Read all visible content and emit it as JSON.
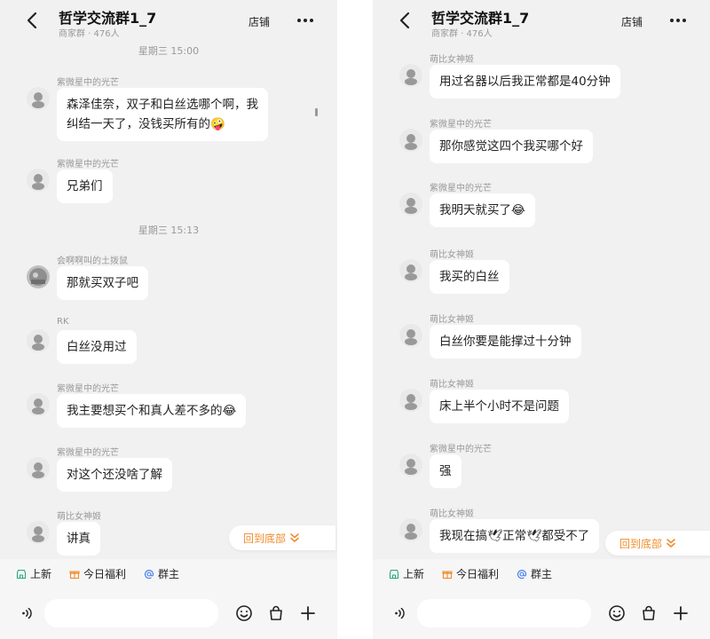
{
  "left": {
    "header": {
      "title": "哲学交流群1_7",
      "subtitle": "商家群 · 476人",
      "store_label": "店铺"
    },
    "timestamps": [
      "星期三 15:00",
      "星期三 15:13"
    ],
    "messages": [
      {
        "sender": "紫微星中的光芒",
        "lines": [
          "森泽佳奈，双子和白丝选哪个啊，我",
          "纠结一天了，没钱买所有的🤪"
        ]
      },
      {
        "sender": "紫微星中的光芒",
        "lines": [
          "兄弟们"
        ]
      },
      {
        "sender": "会啊啊叫的土拨鼠",
        "lines": [
          "那就买双子吧"
        ]
      },
      {
        "sender": "RK",
        "lines": [
          "白丝没用过"
        ]
      },
      {
        "sender": "紫微星中的光芒",
        "lines": [
          "我主要想买个和真人差不多的😂"
        ]
      },
      {
        "sender": "紫微星中的光芒",
        "lines": [
          "对这个还没啥了解"
        ]
      },
      {
        "sender": "萌比女神姬",
        "lines": [
          "讲真"
        ]
      }
    ],
    "jump_label": "回到底部",
    "shortcuts": [
      "上新",
      "今日福利",
      "群主"
    ]
  },
  "right": {
    "header": {
      "title": "哲学交流群1_7",
      "subtitle": "商家群 · 476人",
      "store_label": "店铺"
    },
    "messages": [
      {
        "sender": "萌比女神姬",
        "lines": [
          "用过名器以后我正常都是40分钟"
        ]
      },
      {
        "sender": "紫微星中的光芒",
        "lines": [
          "那你感觉这四个我买哪个好"
        ]
      },
      {
        "sender": "紫微星中的光芒",
        "lines": [
          "我明天就买了😂"
        ]
      },
      {
        "sender": "萌比女神姬",
        "lines": [
          "我买的白丝"
        ]
      },
      {
        "sender": "萌比女神姬",
        "lines": [
          "白丝你要是能撑过十分钟"
        ]
      },
      {
        "sender": "萌比女神姬",
        "lines": [
          "床上半个小时不是问题"
        ]
      },
      {
        "sender": "紫微星中的光芒",
        "lines": [
          "强"
        ]
      },
      {
        "sender": "萌比女神姬",
        "lines": [
          "我现在搞🕊正常🕊都受不了"
        ]
      }
    ],
    "jump_label": "回到底部",
    "shortcuts": [
      "上新",
      "今日福利",
      "群主"
    ]
  }
}
